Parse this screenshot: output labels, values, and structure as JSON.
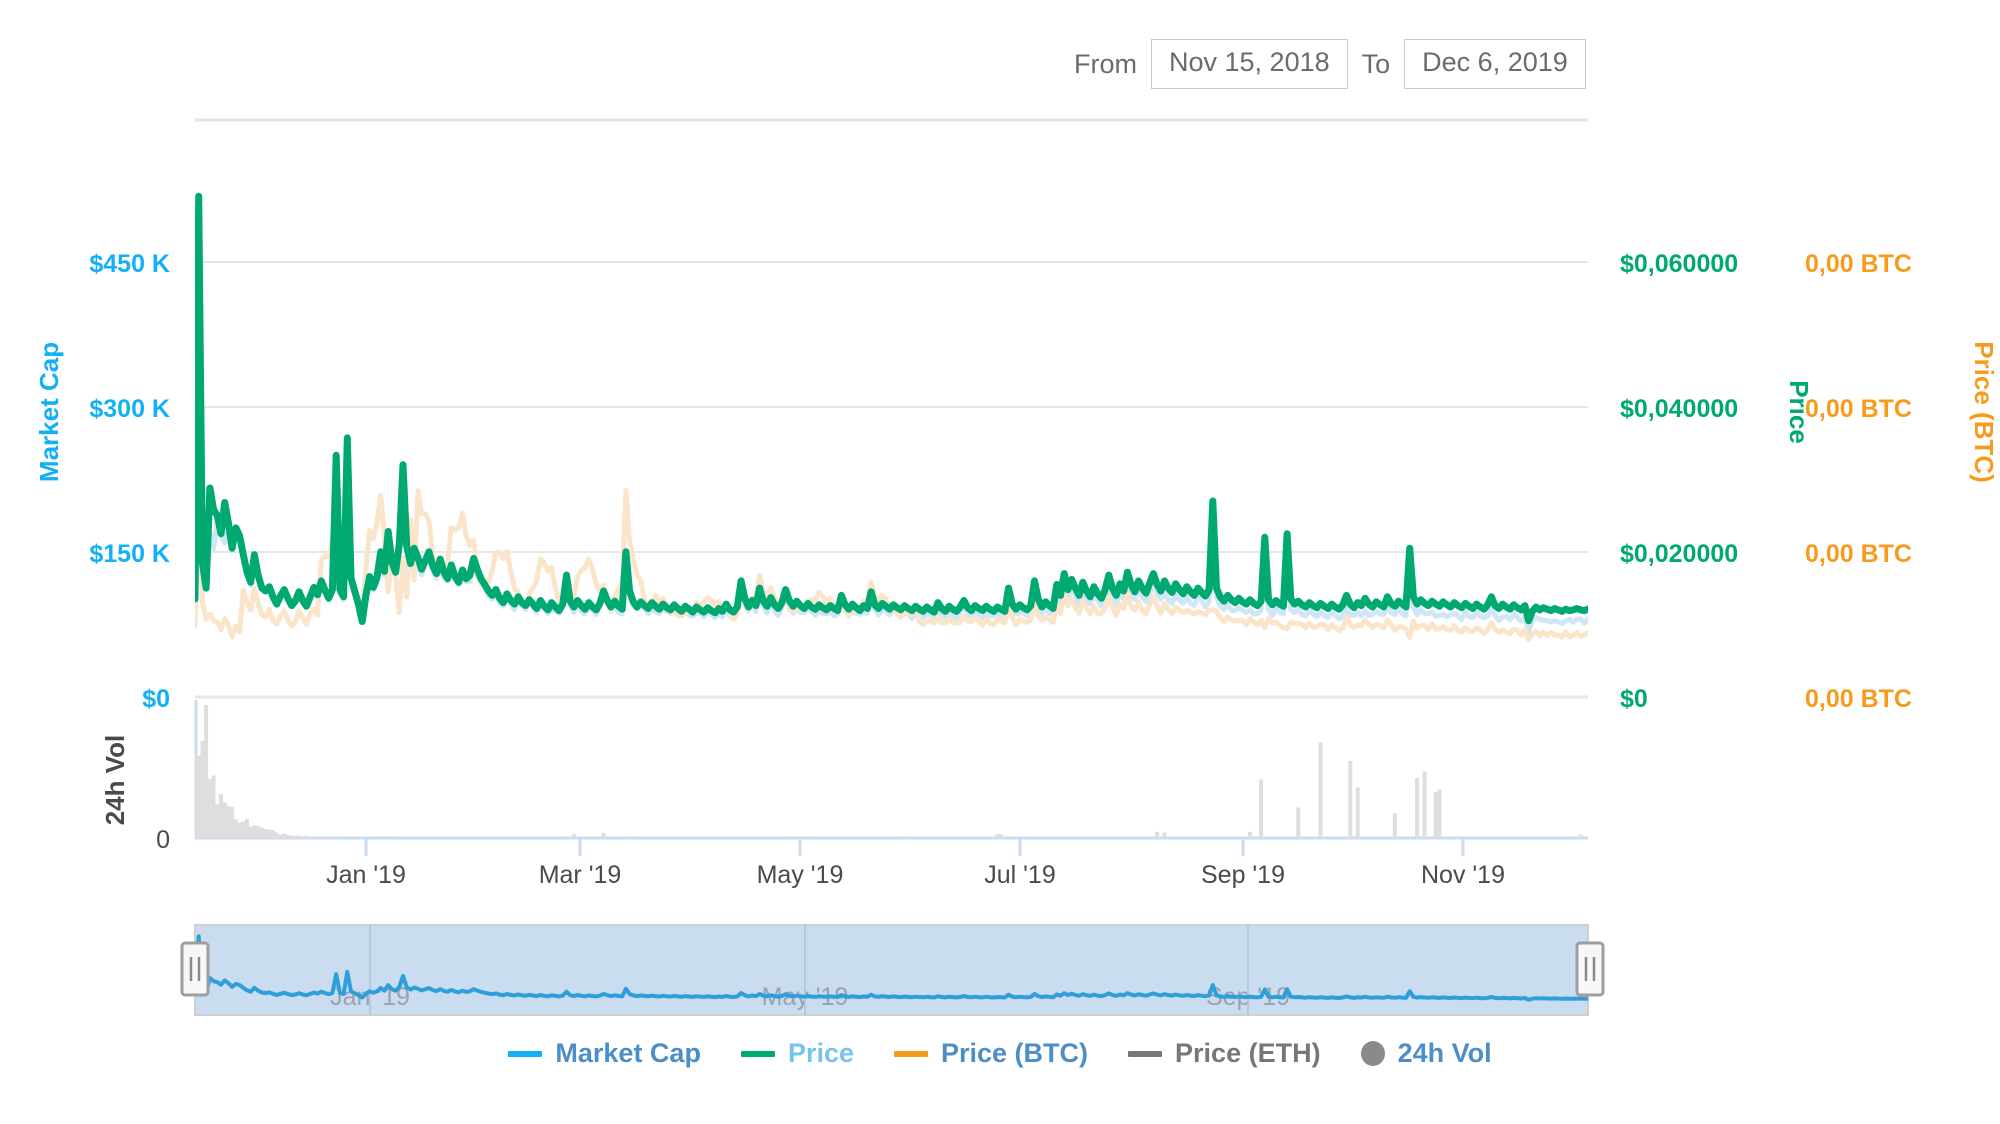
{
  "controls": {
    "from_label": "From",
    "from_value": "Nov 15, 2018",
    "to_label": "To",
    "to_value": "Dec 6, 2019"
  },
  "axes": {
    "left": {
      "title": "Market Cap",
      "color": "#13b0f5",
      "ticks": [
        "$450 K",
        "$300 K",
        "$150 K",
        "$0"
      ]
    },
    "right_price": {
      "title": "Price",
      "color": "#00a971",
      "ticks": [
        "$0,060000",
        "$0,040000",
        "$0,020000",
        "$0"
      ]
    },
    "right_btc": {
      "title": "Price (BTC)",
      "color": "#f79b1e",
      "ticks": [
        "0,00 BTC",
        "0,00 BTC",
        "0,00 BTC",
        "0,00 BTC"
      ]
    },
    "volume": {
      "title": "24h Vol",
      "color": "#4a4a4a",
      "ticks": [
        "0"
      ]
    },
    "x": {
      "ticks": [
        "Jan '19",
        "Mar '19",
        "May '19",
        "Jul '19",
        "Sep '19",
        "Nov '19"
      ]
    }
  },
  "navigator": {
    "date_labels": [
      "Jan '19",
      "May '19",
      "Sep '19"
    ],
    "handle_left": "navigator-handle-left",
    "handle_right": "navigator-handle-right"
  },
  "legend": [
    {
      "label": "Market Cap",
      "marker": "dash",
      "marker_color": "#13b0f5",
      "text_color": "#4d8fc4",
      "active": true
    },
    {
      "label": "Price",
      "marker": "dash",
      "marker_color": "#00a971",
      "text_color": "#77c4ec",
      "active": true
    },
    {
      "label": "Price (BTC)",
      "marker": "dash",
      "marker_color": "#f79b1e",
      "text_color": "#4d8fc4",
      "active": true
    },
    {
      "label": "Price (ETH)",
      "marker": "dash",
      "marker_color": "#777777",
      "text_color": "#777777",
      "active": false
    },
    {
      "label": "24h Vol",
      "marker": "circle",
      "marker_color": "#8a8a8a",
      "text_color": "#4d8fc4",
      "active": true
    }
  ],
  "chart_data": {
    "type": "line",
    "title": "",
    "xlabel": "",
    "x_range": [
      "Nov 15, 2018",
      "Dec 6, 2019"
    ],
    "x_tick_labels": [
      "Jan '19",
      "Mar '19",
      "May '19",
      "Jul '19",
      "Sep '19",
      "Nov '19"
    ],
    "grid": true,
    "legend_position": "bottom",
    "axes": {
      "market_cap": {
        "label": "Market Cap",
        "ticks": [
          450000,
          300000,
          150000,
          0
        ],
        "tick_labels": [
          "$450 K",
          "$300 K",
          "$150 K",
          "$0"
        ],
        "ylim": [
          0,
          600000
        ],
        "color": "#13b0f5"
      },
      "price": {
        "label": "Price",
        "ticks": [
          0.06,
          0.04,
          0.02,
          0
        ],
        "tick_labels": [
          "$0,060000",
          "$0,040000",
          "$0,020000",
          "$0"
        ],
        "ylim": [
          0,
          0.08
        ],
        "color": "#00a971"
      },
      "price_btc": {
        "label": "Price (BTC)",
        "ticks": [
          0,
          0,
          0,
          0
        ],
        "tick_labels": [
          "0,00 BTC",
          "0,00 BTC",
          "0,00 BTC",
          "0,00 BTC"
        ],
        "color": "#f79b1e"
      },
      "volume": {
        "label": "24h Vol",
        "ticks": [
          0
        ],
        "tick_labels": [
          "0"
        ],
        "color": "#cfcfcf"
      }
    },
    "series": [
      {
        "name": "Price",
        "color": "#00a971",
        "axis": "price",
        "values": [
          0.0135,
          0.069,
          0.0185,
          0.015,
          0.0288,
          0.0258,
          0.025,
          0.0225,
          0.0268,
          0.024,
          0.0205,
          0.0233,
          0.0222,
          0.0196,
          0.0172,
          0.0158,
          0.0196,
          0.0168,
          0.015,
          0.0146,
          0.0152,
          0.0138,
          0.0128,
          0.0139,
          0.0148,
          0.0136,
          0.0126,
          0.0132,
          0.0145,
          0.0133,
          0.0125,
          0.0138,
          0.0151,
          0.0141,
          0.016,
          0.0147,
          0.0136,
          0.0148,
          0.0333,
          0.0148,
          0.0138,
          0.0357,
          0.0164,
          0.0146,
          0.0128,
          0.0104,
          0.014,
          0.0166,
          0.0151,
          0.0165,
          0.02,
          0.0173,
          0.0228,
          0.0186,
          0.0172,
          0.021,
          0.032,
          0.0208,
          0.0184,
          0.0205,
          0.0192,
          0.0176,
          0.0188,
          0.02,
          0.0181,
          0.017,
          0.019,
          0.0172,
          0.0163,
          0.0182,
          0.0166,
          0.0158,
          0.0175,
          0.0163,
          0.0168,
          0.0191,
          0.0176,
          0.0163,
          0.0155,
          0.0146,
          0.014,
          0.0148,
          0.0136,
          0.013,
          0.0142,
          0.0133,
          0.0128,
          0.0138,
          0.013,
          0.0126,
          0.0134,
          0.0128,
          0.0122,
          0.0133,
          0.0125,
          0.012,
          0.013,
          0.0124,
          0.0119,
          0.0128,
          0.0168,
          0.0132,
          0.0124,
          0.0133,
          0.0126,
          0.0121,
          0.013,
          0.0124,
          0.012,
          0.0129,
          0.0146,
          0.0133,
          0.0124,
          0.0132,
          0.0125,
          0.0121,
          0.02,
          0.0146,
          0.0131,
          0.0124,
          0.0131,
          0.0126,
          0.0122,
          0.013,
          0.0125,
          0.0121,
          0.0128,
          0.0123,
          0.012,
          0.0127,
          0.0122,
          0.0118,
          0.0125,
          0.0121,
          0.0117,
          0.0124,
          0.012,
          0.0117,
          0.0123,
          0.0119,
          0.0116,
          0.0122,
          0.0118,
          0.0128,
          0.012,
          0.0117,
          0.0124,
          0.016,
          0.0136,
          0.0124,
          0.0133,
          0.0126,
          0.015,
          0.0132,
          0.0125,
          0.0137,
          0.0127,
          0.0122,
          0.013,
          0.0148,
          0.0133,
          0.0125,
          0.0132,
          0.0126,
          0.0122,
          0.0129,
          0.0124,
          0.0121,
          0.0127,
          0.0123,
          0.012,
          0.0126,
          0.0122,
          0.0119,
          0.014,
          0.0127,
          0.0121,
          0.0128,
          0.0123,
          0.0119,
          0.0126,
          0.0122,
          0.0145,
          0.0127,
          0.0122,
          0.0129,
          0.0125,
          0.0121,
          0.0127,
          0.0123,
          0.012,
          0.0126,
          0.0122,
          0.0119,
          0.0125,
          0.0121,
          0.0118,
          0.0124,
          0.012,
          0.0117,
          0.013,
          0.0122,
          0.0118,
          0.0125,
          0.0121,
          0.0118,
          0.0124,
          0.0133,
          0.0123,
          0.0119,
          0.0126,
          0.0122,
          0.0119,
          0.0125,
          0.0121,
          0.0118,
          0.0124,
          0.0121,
          0.0118,
          0.015,
          0.0128,
          0.0121,
          0.0127,
          0.0123,
          0.012,
          0.0126,
          0.016,
          0.0135,
          0.0124,
          0.0131,
          0.0126,
          0.0122,
          0.0155,
          0.014,
          0.017,
          0.0148,
          0.0162,
          0.015,
          0.014,
          0.0158,
          0.0146,
          0.0138,
          0.0152,
          0.0142,
          0.0136,
          0.0148,
          0.0168,
          0.015,
          0.014,
          0.0156,
          0.0146,
          0.0172,
          0.0155,
          0.0145,
          0.016,
          0.015,
          0.0143,
          0.0157,
          0.017,
          0.0155,
          0.0146,
          0.016,
          0.015,
          0.0144,
          0.0156,
          0.0148,
          0.0142,
          0.0152,
          0.0145,
          0.014,
          0.015,
          0.0144,
          0.0139,
          0.0148,
          0.027,
          0.015,
          0.0138,
          0.0132,
          0.014,
          0.0134,
          0.013,
          0.0136,
          0.0131,
          0.0128,
          0.0134,
          0.0129,
          0.0126,
          0.0132,
          0.022,
          0.0134,
          0.0127,
          0.0133,
          0.0128,
          0.0125,
          0.0225,
          0.0135,
          0.0128,
          0.0132,
          0.0127,
          0.0124,
          0.013,
          0.0126,
          0.0123,
          0.0129,
          0.0125,
          0.0122,
          0.0128,
          0.0124,
          0.0121,
          0.0127,
          0.014,
          0.0128,
          0.0123,
          0.013,
          0.0126,
          0.0136,
          0.0128,
          0.0124,
          0.0131,
          0.0127,
          0.0124,
          0.0138,
          0.0129,
          0.0125,
          0.0132,
          0.0128,
          0.0124,
          0.0205,
          0.0138,
          0.0128,
          0.0134,
          0.0129,
          0.0126,
          0.0132,
          0.0128,
          0.0125,
          0.0131,
          0.0127,
          0.0124,
          0.013,
          0.0126,
          0.0123,
          0.0129,
          0.0125,
          0.0122,
          0.0128,
          0.0124,
          0.0121,
          0.0127,
          0.0138,
          0.0126,
          0.0122,
          0.0128,
          0.0124,
          0.0121,
          0.0127,
          0.0123,
          0.012,
          0.0126,
          0.0105,
          0.0118,
          0.0124,
          0.012,
          0.0123,
          0.0121,
          0.0119,
          0.0122,
          0.012,
          0.0118,
          0.0121,
          0.0119,
          0.012,
          0.0122,
          0.012,
          0.0119,
          0.0121
        ]
      },
      {
        "name": "Market Cap",
        "color": "#cfe6f7",
        "axis": "market_cap",
        "note": "faint light-blue line tracking just above/below the price line"
      },
      {
        "name": "Price (BTC)",
        "color": "#fae5cb",
        "axis": "price_btc",
        "note": "faint light-orange line, higher than price early in range, lower after July"
      },
      {
        "name": "Price (ETH)",
        "color": "#777777",
        "axis": "price",
        "note": "series toggled off - not drawn"
      },
      {
        "name": "24h Vol",
        "color": "#dcdcdc",
        "axis": "volume",
        "type": "bar",
        "note": "grey volume bars, large at start of range, isolated spikes in October"
      }
    ]
  }
}
